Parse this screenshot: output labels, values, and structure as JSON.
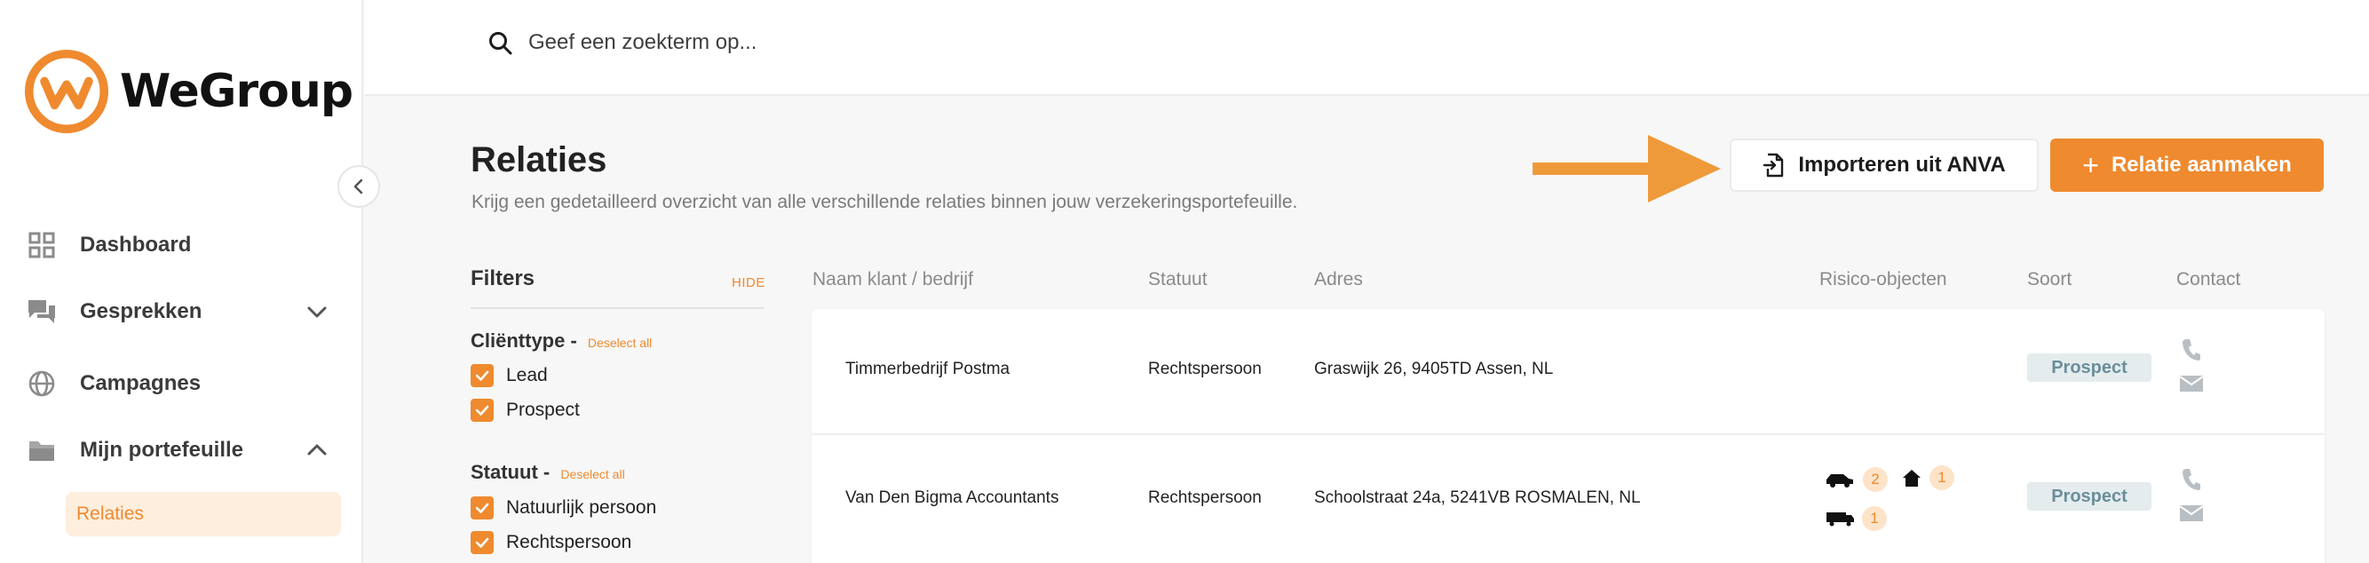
{
  "brand": {
    "name": "WeGroup",
    "accent": "#ef8a2f"
  },
  "search": {
    "placeholder": "Geef een zoekterm op..."
  },
  "sidebar": {
    "items": [
      {
        "label": "Dashboard",
        "icon": "grid-icon"
      },
      {
        "label": "Gesprekken",
        "icon": "chat-icon",
        "chevron": "chevron-down-icon"
      },
      {
        "label": "Campagnes",
        "icon": "globe-icon"
      },
      {
        "label": "Mijn portefeuille",
        "icon": "folder-icon",
        "chevron": "chevron-up-icon"
      }
    ],
    "sub_items": [
      {
        "label": "Relaties",
        "active": true
      }
    ]
  },
  "header": {
    "title": "Relaties",
    "subtitle": "Krijg een gedetailleerd overzicht van alle verschillende relaties binnen jouw verzekeringsportefeuille.",
    "import_label": "Importeren uit ANVA",
    "create_label": "Relatie aanmaken"
  },
  "filters": {
    "title": "Filters",
    "hide_label": "HIDE",
    "groups": [
      {
        "title": "Cliënttype -",
        "deselect": "Deselect all",
        "options": [
          {
            "label": "Lead",
            "checked": true
          },
          {
            "label": "Prospect",
            "checked": true
          }
        ]
      },
      {
        "title": "Statuut -",
        "deselect": "Deselect all",
        "options": [
          {
            "label": "Natuurlijk persoon",
            "checked": true
          },
          {
            "label": "Rechtspersoon",
            "checked": true
          }
        ]
      }
    ]
  },
  "table": {
    "columns": [
      "Naam klant / bedrijf",
      "Statuut",
      "Adres",
      "Risico-objecten",
      "Soort",
      "Contact"
    ],
    "rows": [
      {
        "name": "Timmerbedrijf Postma",
        "statuut": "Rechtspersoon",
        "adres": "Graswijk 26, 9405TD Assen, NL",
        "risks": [],
        "soort": "Prospect"
      },
      {
        "name": "Van Den Bigma Accountants",
        "statuut": "Rechtspersoon",
        "adres": "Schoolstraat 24a, 5241VB ROSMALEN, NL",
        "risks": [
          {
            "icon": "car-icon",
            "count": "2"
          },
          {
            "icon": "house-icon",
            "count": "1"
          },
          {
            "icon": "truck-icon",
            "count": "1"
          }
        ],
        "soort": "Prospect"
      }
    ]
  }
}
